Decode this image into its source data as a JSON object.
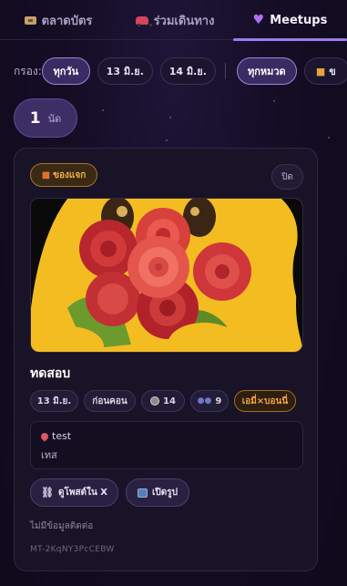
{
  "tabs": [
    {
      "label": "ตลาดบัตร",
      "icon": "ticket-icon"
    },
    {
      "label": "ร่วมเดินทาง",
      "icon": "car-icon"
    },
    {
      "label": "Meetups",
      "icon": "purple-heart-icon"
    }
  ],
  "filters": {
    "label": "กรอง:",
    "dates": [
      "ทุกวัน",
      "13 มิ.ย.",
      "14 มิ.ย."
    ],
    "categories": [
      "ทุกหมวด",
      "ข"
    ]
  },
  "count": {
    "value": "1",
    "unit": "นัด"
  },
  "card": {
    "gift_badge": "ของแจก",
    "close_label": "ปิด",
    "title": "ทดสอบ",
    "tags": {
      "date": "13 มิ.ย.",
      "timing": "ก่อนคอน",
      "time": "14",
      "people": "9",
      "artist": "เอมี่×บอนนี่"
    },
    "location": {
      "name": "test",
      "detail": "เทส"
    },
    "buttons": {
      "view_post": "ดูโพสต์ใน X",
      "open_image": "เปิดรูป"
    },
    "no_contact": "ไม่มีข้อมูลติดต่อ",
    "id": "MT-2KqNY3PcCEBW"
  },
  "colors": {
    "accent": "#9b7cf0",
    "gift": "#f2b24a",
    "artist_tag": "#f0a548"
  }
}
